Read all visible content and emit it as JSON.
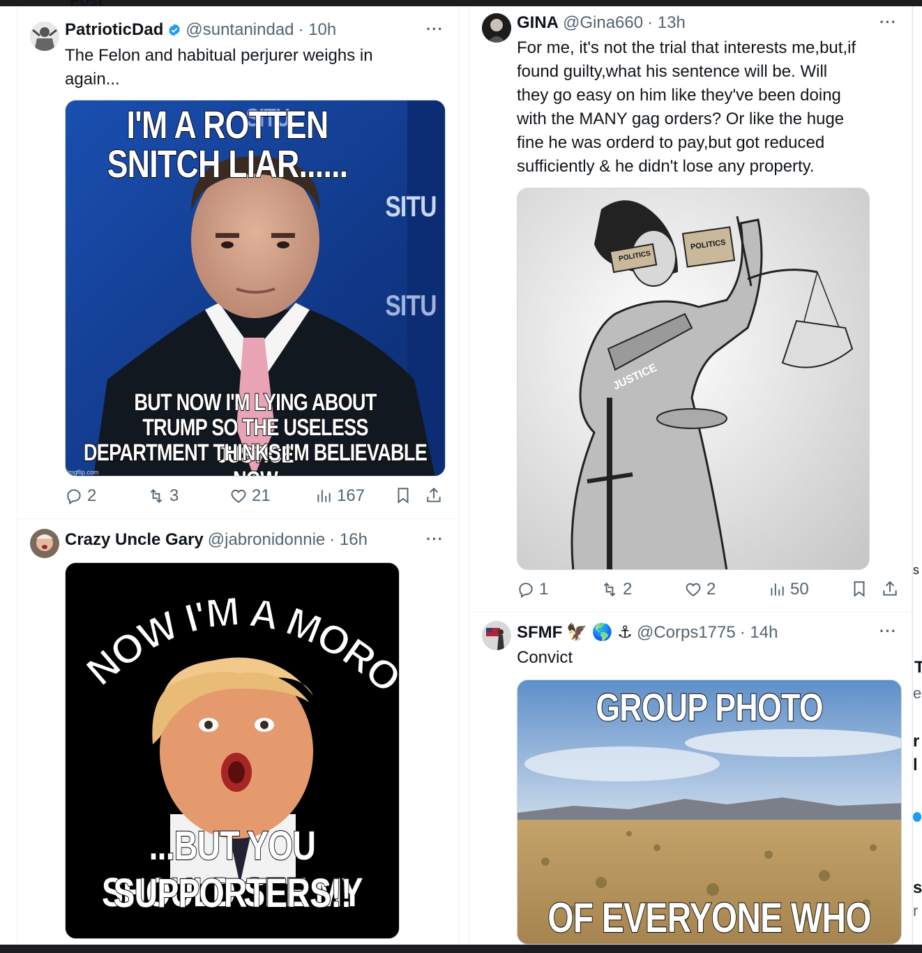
{
  "page": {
    "header_fragment": "Post"
  },
  "tweets": [
    {
      "name": "PatrioticDad",
      "handle": "@suntanindad",
      "time": "· 10h",
      "verified": true,
      "text": "The Felon and habitual perjurer weighs in again...",
      "media": {
        "top_text_1": "I'M A ROTTEN",
        "top_text_2": "SNITCH LIAR......",
        "bottom_text_1": "BUT NOW I'M LYING ABOUT",
        "bottom_text_2": "TRUMP SO THE USELESS JUSTICE",
        "bottom_text_3": "DEPARTMENT THINKS I'M BELIEVABLE NOW",
        "bg_text_1": "SITU",
        "bg_text_2": "SITU",
        "bg_text_3": "SITU",
        "watermark": "imgflip.com"
      },
      "replies": "2",
      "reposts": "3",
      "likes": "21",
      "views": "167"
    },
    {
      "name": "Crazy Uncle Gary",
      "handle": "@jabronidonnie",
      "time": "· 16h",
      "verified": false,
      "text": "",
      "media": {
        "arc_text": "I KNOW I'M A MORON.",
        "bottom_text_1": "...BUT YOU SHOULD SEE MY",
        "bottom_text_2": "SUPPORTERS!!"
      }
    },
    {
      "name": "GINA",
      "handle": "@Gina660",
      "time": "· 13h",
      "verified": false,
      "text_lines": [
        "For me, it's not the trial that interests me,but,if",
        "found guilty,what his sentence will be. Will",
        "they go easy on him like they've been doing",
        "with the MANY gag orders? Or like the huge",
        "fine he was orderd to pay,but got reduced",
        "sufficiently & he didn't lose any property."
      ],
      "media": {
        "blindfold_left": "POLITICS",
        "blindfold_right": "POLITICS",
        "sash": "JUSTICE"
      },
      "replies": "1",
      "reposts": "2",
      "likes": "2",
      "views": "50"
    },
    {
      "name": "SFMF",
      "emojis": "🦅 🌎 ⚓",
      "handle": "@Corps1775",
      "time": "· 14h",
      "verified": false,
      "text": "Convict",
      "media": {
        "top_text": "GROUP PHOTO",
        "bottom_text": "OF EVERYONE WHO CARES"
      }
    }
  ],
  "far_column_fragments": [
    "s",
    "T",
    "e",
    "r",
    "l",
    "s",
    "r"
  ],
  "colors": {
    "text": "#0f1419",
    "secondary": "#536471",
    "verified": "#1d9bf0",
    "border": "#eff3f4"
  },
  "icons": [
    "reply-icon",
    "repost-icon",
    "like-icon",
    "views-icon",
    "bookmark-icon",
    "share-icon",
    "more-icon",
    "verified-icon"
  ]
}
